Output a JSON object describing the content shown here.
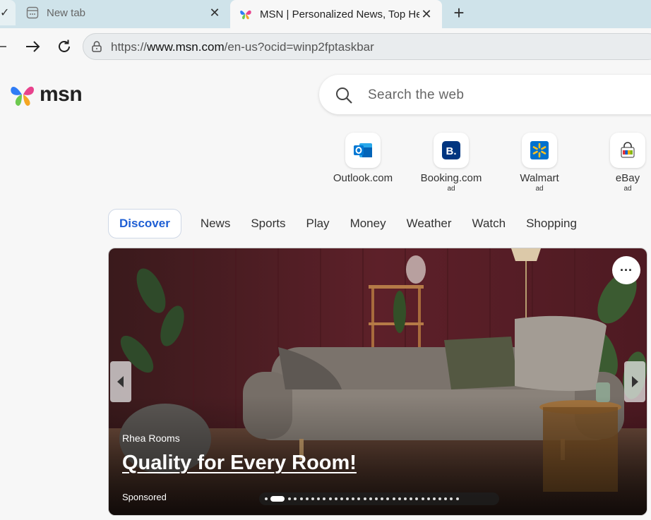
{
  "browser": {
    "tabs": [
      {
        "title": "New tab",
        "active": false
      },
      {
        "title": "MSN | Personalized News, Top Headlines",
        "active": true
      }
    ],
    "address": {
      "prefix": "https://",
      "domain": "www.msn.com",
      "path": "/en-us?ocid=winp2fptaskbar"
    }
  },
  "page": {
    "logo_text": "msn",
    "search_placeholder": "Search the web",
    "quicklinks": [
      {
        "label": "Outlook.com",
        "ad": "",
        "icon": "outlook-icon"
      },
      {
        "label": "Booking.com",
        "ad": "ad",
        "icon": "booking-icon"
      },
      {
        "label": "Walmart",
        "ad": "ad",
        "icon": "walmart-icon"
      },
      {
        "label": "eBay",
        "ad": "ad",
        "icon": "ebay-icon"
      }
    ],
    "nav": [
      "Discover",
      "News",
      "Sports",
      "Play",
      "Money",
      "Weather",
      "Watch",
      "Shopping"
    ],
    "hero": {
      "brand": "Rhea Rooms",
      "headline": "Quality for Every Room!",
      "sponsored": "Sponsored",
      "slide_count": 32,
      "active_slide": 2
    }
  }
}
